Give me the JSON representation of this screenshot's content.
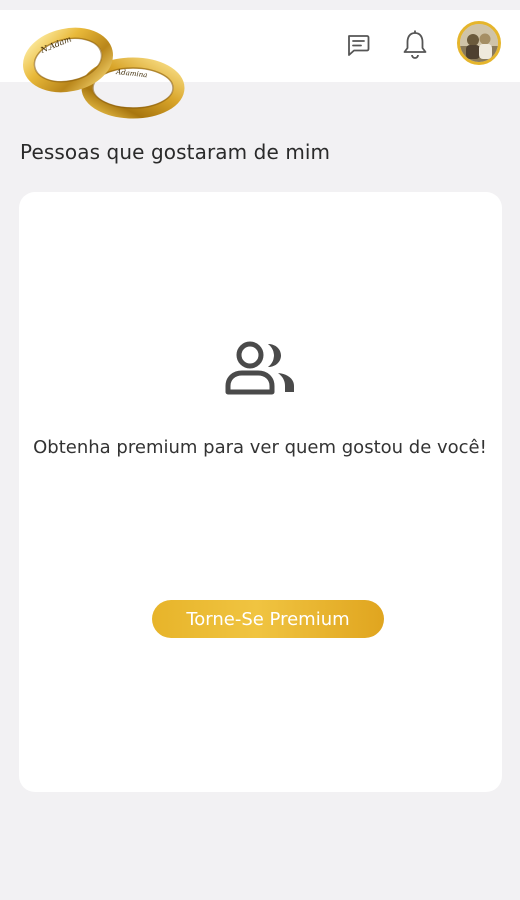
{
  "header": {
    "logo_icon": "wedding-rings-logo",
    "logo_engravings": [
      "N.Adam",
      "Adamina"
    ],
    "messages_icon": "chat-icon",
    "notifications_icon": "bell-icon",
    "avatar_icon": "user-avatar"
  },
  "page": {
    "title": "Pessoas que gostaram de mim"
  },
  "card": {
    "icon": "people-icon",
    "message": "Obtenha premium para ver quem gostou de você!",
    "button_label": "Torne-Se Premium"
  },
  "colors": {
    "accent_gold": "#e8b52c",
    "background": "#f2f1f3",
    "card": "#ffffff"
  }
}
